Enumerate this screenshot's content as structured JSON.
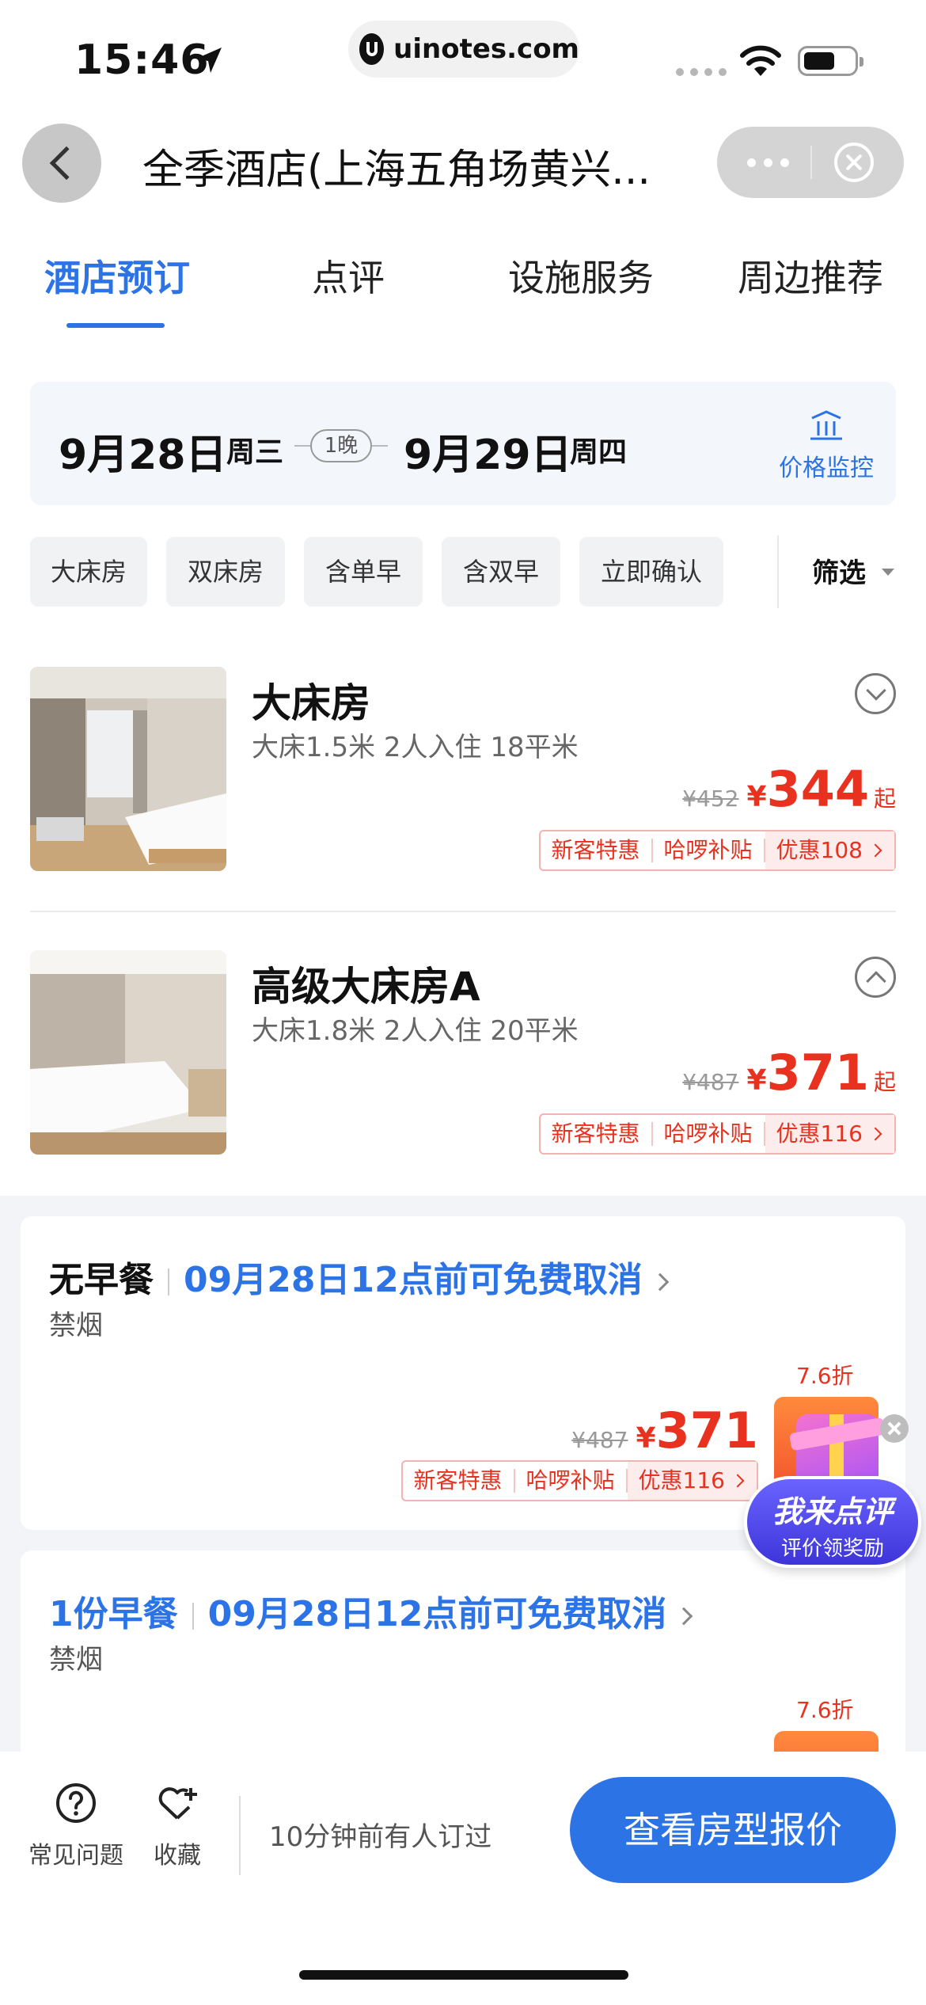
{
  "status": {
    "time": "15:46",
    "url": "uinotes.com"
  },
  "nav": {
    "title": "全季酒店(上海五角场黄兴..."
  },
  "tabs": [
    "酒店预订",
    "点评",
    "设施服务",
    "周边推荐"
  ],
  "dates": {
    "checkin": "9月28日",
    "checkin_week": "周三",
    "nights": "1晚",
    "checkout": "9月29日",
    "checkout_week": "周四",
    "price_watch": "价格监控"
  },
  "filters": [
    "大床房",
    "双床房",
    "含单早",
    "含双早",
    "立即确认"
  ],
  "filter_button": "筛选",
  "rooms": [
    {
      "name": "大床房",
      "spec": "大床1.5米 2人入住 18平米",
      "old_price": "¥452",
      "currency": "¥",
      "price": "344",
      "suffix": "起",
      "tags": [
        "新客特惠",
        "哈啰补贴",
        "优惠108"
      ],
      "expanded": false
    },
    {
      "name": "高级大床房A",
      "spec": "大床1.8米 2人入住 20平米",
      "old_price": "¥487",
      "currency": "¥",
      "price": "371",
      "suffix": "起",
      "tags": [
        "新客特惠",
        "哈啰补贴",
        "优惠116"
      ],
      "expanded": true
    }
  ],
  "plans": [
    {
      "meal": "无早餐",
      "cancel": "09月28日12点前可免费取消",
      "smoke": "禁烟",
      "discount": "7.6折",
      "old_price": "¥487",
      "currency": "¥",
      "price": "371",
      "tags": [
        "新客特惠",
        "哈啰补贴",
        "优惠116"
      ]
    },
    {
      "meal": "1份早餐",
      "cancel": "09月28日12点前可免费取消",
      "smoke": "禁烟",
      "discount": "7.6折"
    }
  ],
  "review_badge": {
    "title": "我来点评",
    "subtitle": "评价领奖励"
  },
  "bottom": {
    "faq": "常见问题",
    "favorite": "收藏",
    "note": "10分钟前有人订过",
    "cta": "查看房型报价"
  },
  "colors": {
    "accent": "#2c74e6",
    "price": "#e8321f"
  }
}
